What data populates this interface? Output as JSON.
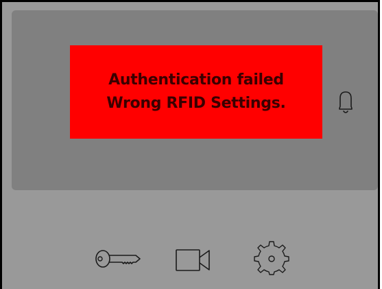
{
  "alert": {
    "line1": "Authentication failed",
    "line2": "Wrong RFID Settings.",
    "background_color": "#ff0000",
    "text_color": "#3a0000"
  },
  "icons": {
    "notification": "bell-icon",
    "toolbar": [
      "key-icon",
      "video-camera-icon",
      "gear-icon"
    ]
  },
  "colors": {
    "panel_background": "#999999",
    "display_background": "#808080"
  }
}
